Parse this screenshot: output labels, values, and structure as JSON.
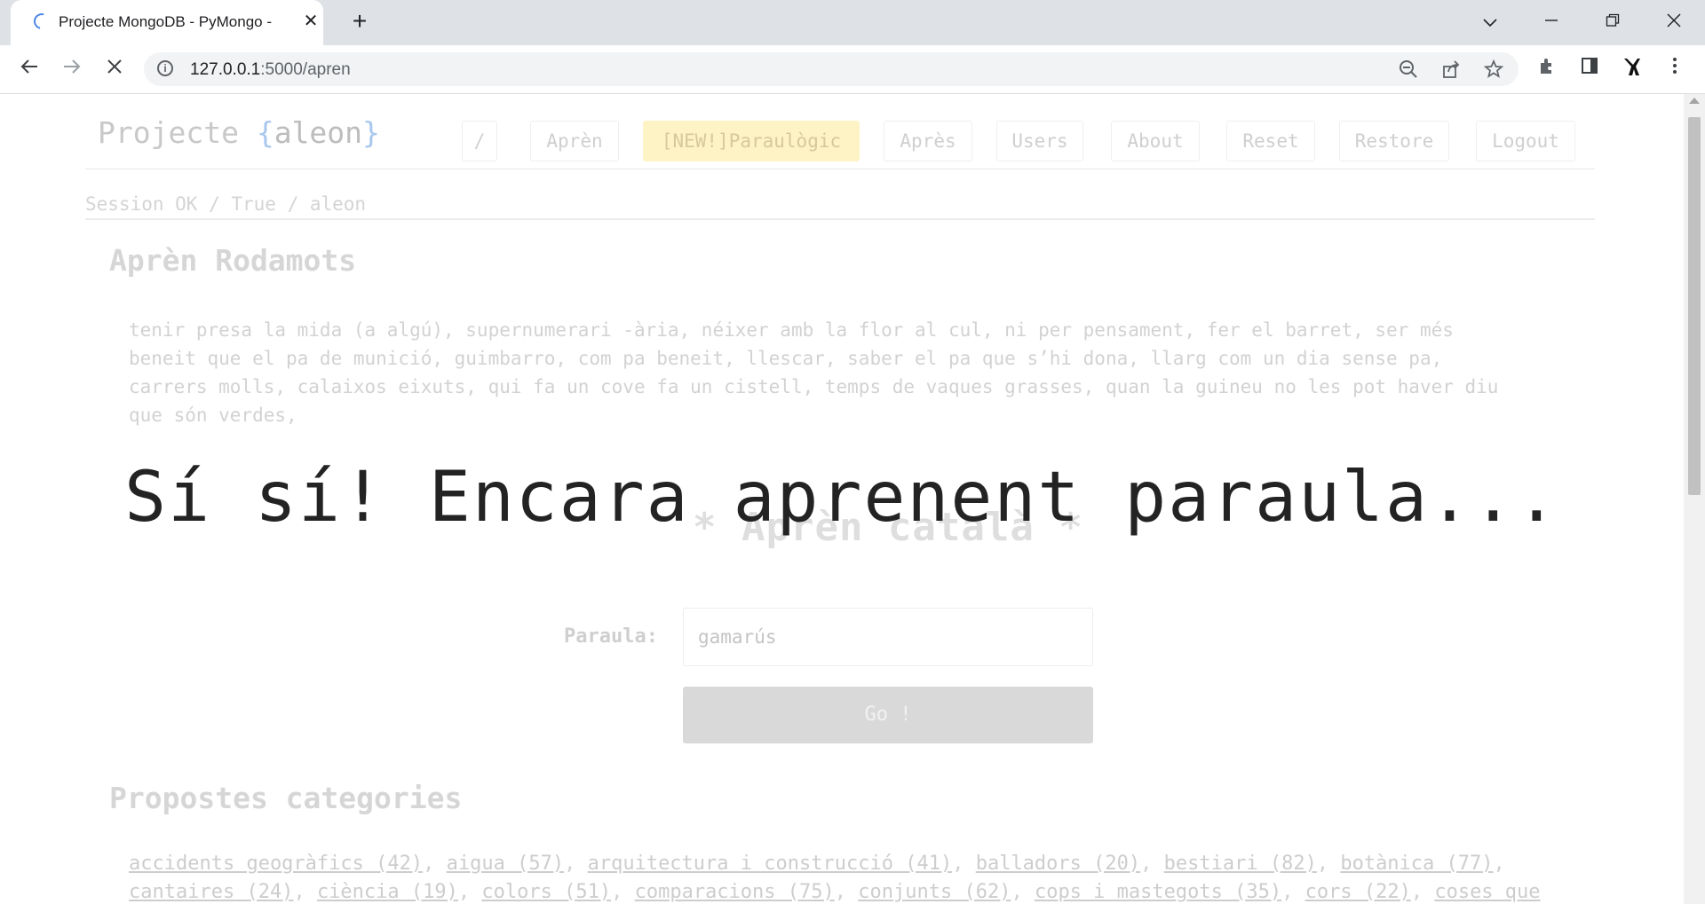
{
  "browser": {
    "tab_title": "Projecte MongoDB - PyMongo - ",
    "tab_close": "✕",
    "new_tab": "+",
    "url_host": "127.0.0.1",
    "url_path": ":5000/apren",
    "icons": [
      "spinner-icon",
      "close-icon",
      "plus-icon",
      "chevron-down-icon",
      "minimize-icon",
      "restore-icon",
      "window-close-icon",
      "back-icon",
      "forward-icon",
      "stop-icon",
      "info-icon",
      "zoom-out-icon",
      "share-icon",
      "star-icon",
      "extensions-icon",
      "side-panel-icon",
      "profile-icon",
      "menu-icon"
    ]
  },
  "site": {
    "brand_prefix": "Projecte ",
    "brand_open": "{",
    "brand_user": "aleon",
    "brand_close": "}",
    "nav": [
      "/",
      "Aprèn",
      "[NEW!]Paraulògic",
      "Après",
      "Users",
      "About",
      "Reset",
      "Restore",
      "Logout"
    ],
    "session": "Session OK / True / aleon"
  },
  "rodamots": {
    "heading": "Aprèn Rodamots",
    "text_lines": [
      "tenir presa la mida (a algú), supernumerari -ària, néixer amb la flor al cul, ni per pensament, fer el barret, ser més",
      "beneit que el pa de munició, guimbarro, com pa beneit, llescar, saber el pa que s’hi dona, llarg com un dia sense pa,",
      "carrers molls, calaixos eixuts, qui fa un cove fa un cistell, temps de vaques grasses, quan la guineu no les pot haver diu",
      "que són verdes,"
    ]
  },
  "apren": {
    "title": "* Aprèn català *",
    "overlay": "Sí sí! Encara aprenent paraula...",
    "label": "Paraula:",
    "value": "gamarús",
    "button": "Go !"
  },
  "categories": {
    "heading": "Propostes categories",
    "line1": [
      "accidents geogràfics (42)",
      "aigua (57)",
      "arquitectura i construcció (41)",
      "balladors (20)",
      "bestiari (82)",
      "botànica (77)"
    ],
    "line2": [
      "cantaires (24)",
      "ciència (19)",
      "colors (51)",
      "comparacions (75)",
      "conjunts (62)",
      "cops i mastegots (35)",
      "cors (22)",
      "coses que"
    ]
  }
}
